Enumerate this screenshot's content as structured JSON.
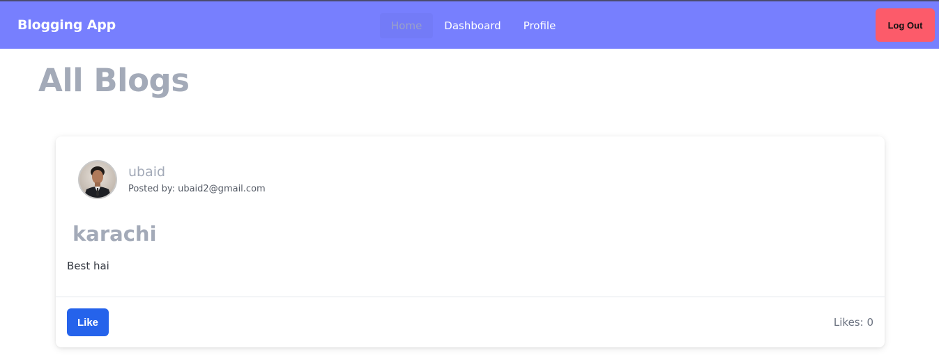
{
  "navbar": {
    "brand": "Blogging App",
    "links": [
      {
        "label": "Home",
        "active": true
      },
      {
        "label": "Dashboard",
        "active": false
      },
      {
        "label": "Profile",
        "active": false
      }
    ],
    "logout_label": "Log Out"
  },
  "page": {
    "title": "All Blogs"
  },
  "posts": [
    {
      "author": "ubaid",
      "posted_by": "Posted by: ubaid2@gmail.com",
      "title": "karachi",
      "body": "Best hai",
      "like_label": "Like",
      "likes_text": "Likes: 0"
    }
  ],
  "colors": {
    "navbar_bg": "#777ffe",
    "logout_bg": "#fc5b6a",
    "like_bg": "#2563eb",
    "title_gray": "#a3aab8"
  }
}
